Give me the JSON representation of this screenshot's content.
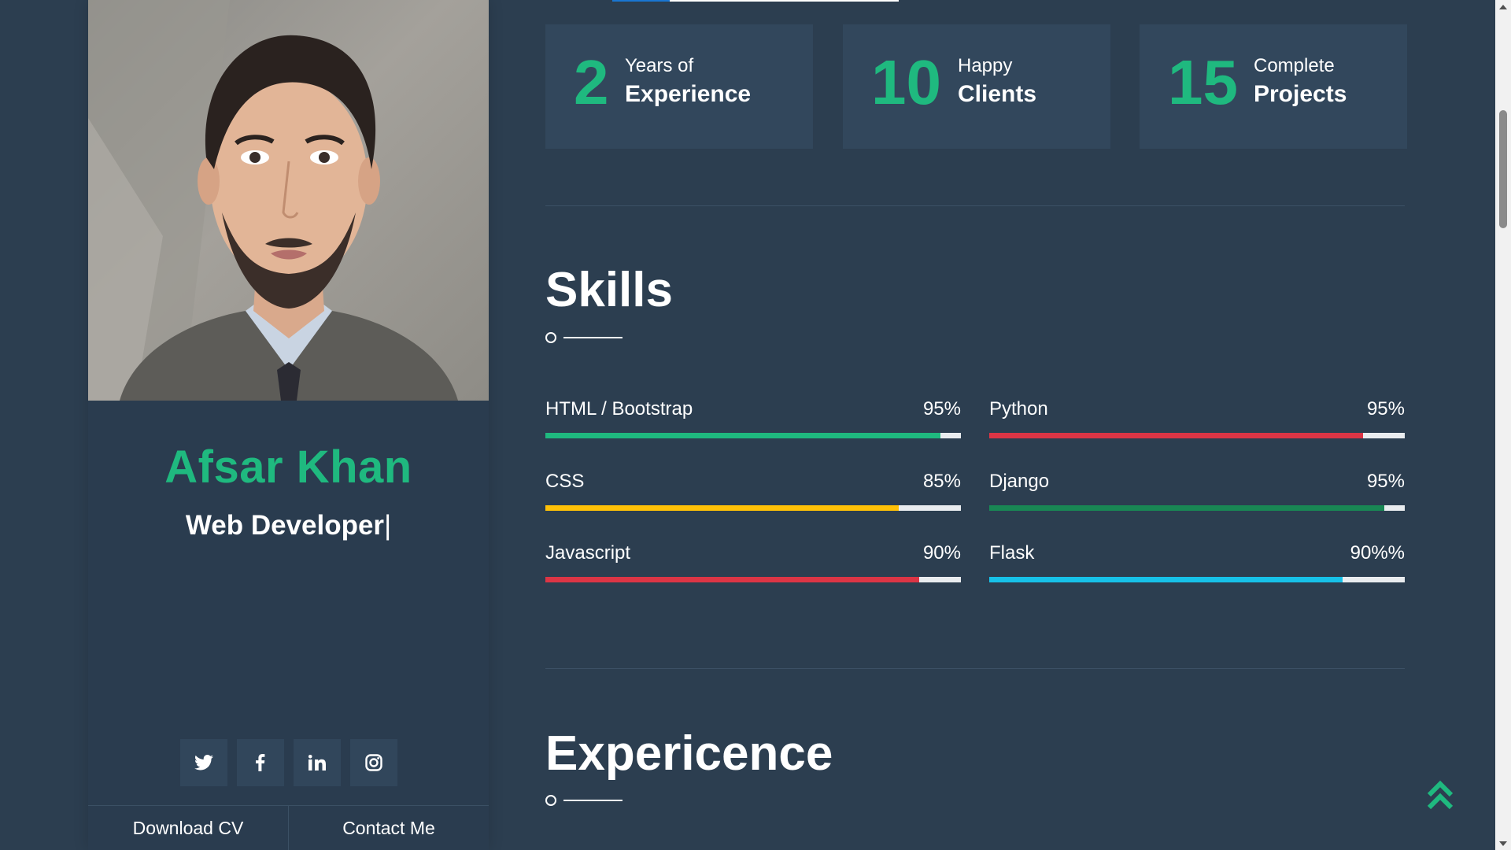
{
  "profile": {
    "name": "Afsar Khan",
    "role": "Web Developer",
    "caret": "|",
    "actions": {
      "download": "Download CV",
      "contact": "Contact Me"
    },
    "socials": [
      "twitter-icon",
      "facebook-icon",
      "linkedin-icon",
      "instagram-icon"
    ]
  },
  "stats": [
    {
      "number": "2",
      "line1": "Years of",
      "line2": "Experience"
    },
    {
      "number": "10",
      "line1": "Happy",
      "line2": "Clients"
    },
    {
      "number": "15",
      "line1": "Complete",
      "line2": "Projects"
    }
  ],
  "skills_section": {
    "title": "Skills",
    "items": [
      {
        "name": "HTML / Bootstrap",
        "percent_label": "95%",
        "level": 0.95,
        "color": "#1fb97f"
      },
      {
        "name": "Python",
        "percent_label": "95%",
        "level": 0.9,
        "color": "#dc3545"
      },
      {
        "name": "CSS",
        "percent_label": "85%",
        "level": 0.85,
        "color": "#ffc107"
      },
      {
        "name": "Django",
        "percent_label": "95%",
        "level": 0.95,
        "color": "#198754"
      },
      {
        "name": "Javascript",
        "percent_label": "90%",
        "level": 0.9,
        "color": "#dc3545"
      },
      {
        "name": "Flask",
        "percent_label": "90%%",
        "level": 0.85,
        "color": "#17c1e8"
      }
    ]
  },
  "experience_section": {
    "title": "Expericence"
  },
  "colors": {
    "background": "#2c3e50",
    "card": "#32475c",
    "accent": "#1fb97f"
  }
}
